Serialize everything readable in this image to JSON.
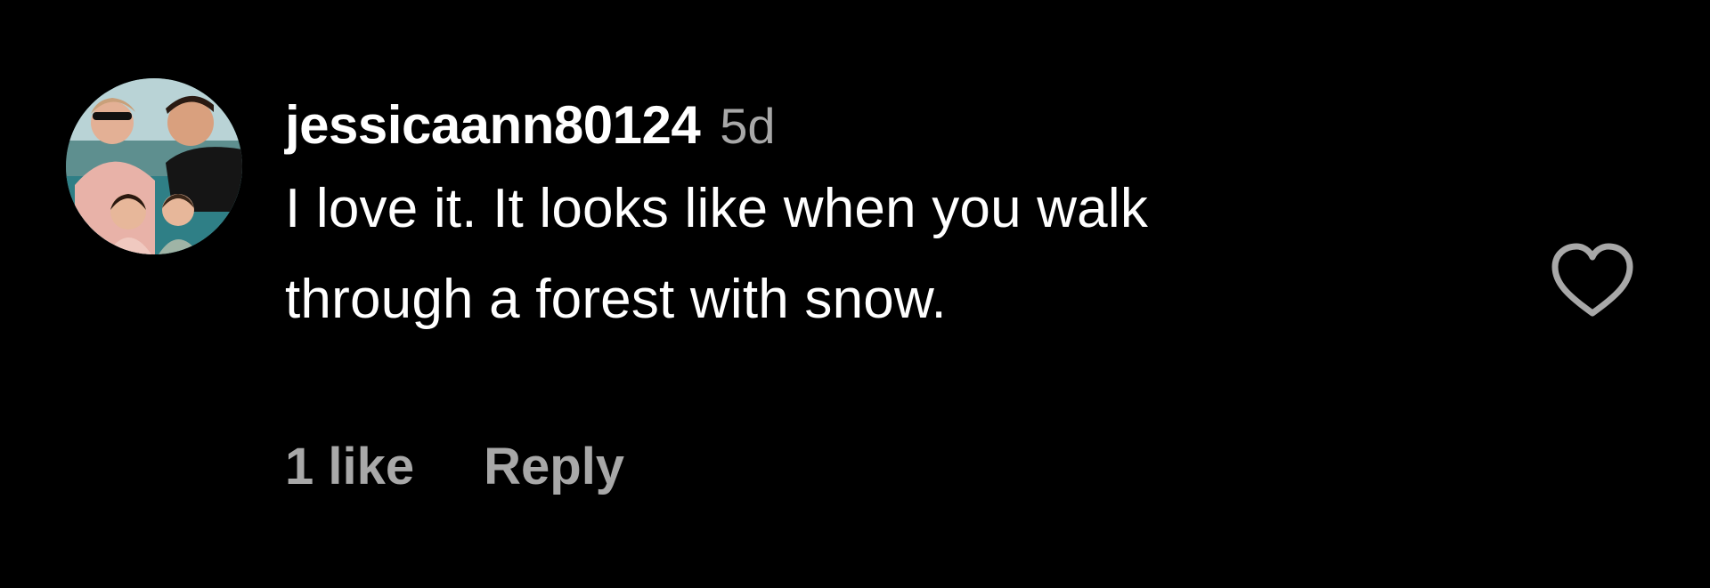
{
  "comment": {
    "avatar_icon": "avatar-family-photo",
    "username": "jessicaann80124",
    "timestamp": "5d",
    "text_lines": [
      "I love it. It looks like when you walk",
      "through a forest with snow."
    ],
    "likes_label": "1 like",
    "reply_label": "Reply",
    "like_icon": "heart-outline-icon"
  },
  "colors": {
    "background": "#000000",
    "primary_text": "#ffffff",
    "secondary_text": "#a8a8a8",
    "icon_stroke": "#a8a8a8"
  }
}
